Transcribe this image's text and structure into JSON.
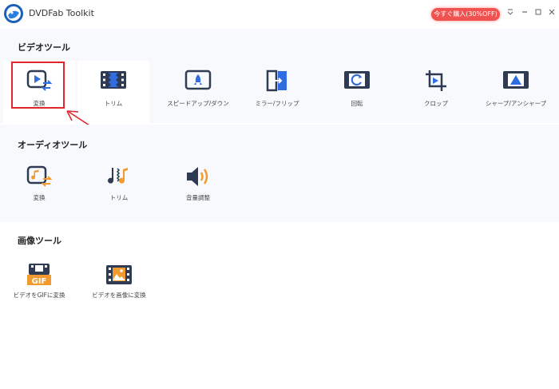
{
  "app": {
    "title": "DVDFab Toolkit"
  },
  "header": {
    "buy_label": "今すぐ購入(30%OFF)"
  },
  "video": {
    "title": "ビデオツール",
    "tools": [
      {
        "label": "変換",
        "icon": "video-convert-icon"
      },
      {
        "label": "トリム",
        "icon": "film-trim-icon"
      },
      {
        "label": "スピードアップ/ダウン",
        "icon": "speed-rocket-icon"
      },
      {
        "label": "ミラー/フリップ",
        "icon": "mirror-flip-icon"
      },
      {
        "label": "回転",
        "icon": "rotate-icon"
      },
      {
        "label": "クロップ",
        "icon": "crop-icon"
      },
      {
        "label": "シャープ/アンシャープ",
        "icon": "sharpen-icon"
      }
    ]
  },
  "audio": {
    "title": "オーディオツール",
    "tools": [
      {
        "label": "変換",
        "icon": "audio-convert-icon"
      },
      {
        "label": "トリム",
        "icon": "audio-trim-icon"
      },
      {
        "label": "音量調整",
        "icon": "volume-icon"
      }
    ]
  },
  "image": {
    "title": "画像ツール",
    "tools": [
      {
        "label": "ビデオをGIFに変換",
        "icon": "gif-icon",
        "badge": "GIF"
      },
      {
        "label": "ビデオを画像に変換",
        "icon": "image-icon"
      }
    ]
  },
  "colors": {
    "accent": "#2f6de1",
    "dark": "#2f3b52",
    "orange": "#f39a2e",
    "highlight": "#e0282c",
    "buy": "#f0524f"
  }
}
